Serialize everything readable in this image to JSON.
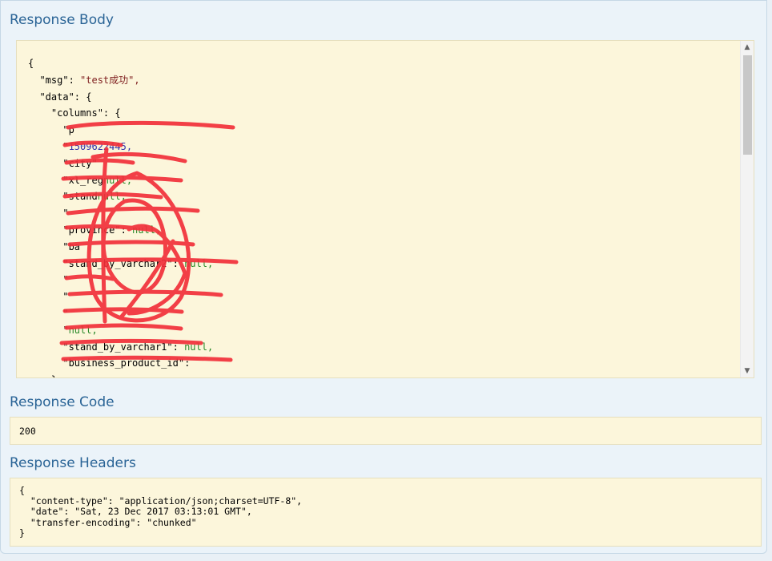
{
  "sections": {
    "response_body": {
      "title": "Response Body",
      "lines": [
        {
          "key": "{",
          "value": "",
          "value_class": ""
        },
        {
          "key": "  \"msg\": ",
          "value": "\"test成功\",",
          "value_class": "str"
        },
        {
          "key": "  \"data\": {",
          "value": "",
          "value_class": ""
        },
        {
          "key": "    \"columns\": {",
          "value": "",
          "value_class": ""
        },
        {
          "key": "      \"p",
          "value": "",
          "value_class": ""
        },
        {
          "key": "      \"",
          "value": "1509622445,",
          "value_class": "num"
        },
        {
          "key": "      \"city\"",
          "value": "",
          "value_class": ""
        },
        {
          "key": "      \"xl_reg",
          "value": "null,",
          "value_class": "nul"
        },
        {
          "key": "      \"stand",
          "value": "null,",
          "value_class": "nul"
        },
        {
          "key": "      \"",
          "value": "",
          "value_class": ""
        },
        {
          "key": "      \"province\": ",
          "value": "null,",
          "value_class": "nul"
        },
        {
          "key": "      \"ba",
          "value": "",
          "value_class": ""
        },
        {
          "key": "      \"stand_by_varchar2\": ",
          "value": "null,",
          "value_class": "nul"
        },
        {
          "key": "      \"",
          "value": "",
          "value_class": ""
        },
        {
          "key": "      \"",
          "value": "",
          "value_class": ""
        },
        {
          "key": "      \"",
          "value": "",
          "value_class": ""
        },
        {
          "key": "      \"",
          "value": "null,",
          "value_class": "nul"
        },
        {
          "key": "      \"stand_by_varchar1\": ",
          "value": "null,",
          "value_class": "nul"
        },
        {
          "key": "      \"business_product_id\": ",
          "value": "",
          "value_class": ""
        },
        {
          "key": "    },",
          "value": "",
          "value_class": ""
        }
      ]
    },
    "response_code": {
      "title": "Response Code",
      "value": "200"
    },
    "response_headers": {
      "title": "Response Headers",
      "lines": [
        "{",
        "  \"content-type\": \"application/json;charset=UTF-8\",",
        "  \"date\": \"Sat, 23 Dec 2017 03:13:01 GMT\",",
        "  \"transfer-encoding\": \"chunked\"",
        "}"
      ]
    }
  },
  "icons": {
    "scroll_up": "chevron-up-icon",
    "scroll_down": "chevron-down-icon"
  },
  "colors": {
    "title": "#2a6496",
    "code_background": "#fcf6db",
    "string": "#7f1f1f",
    "null": "#2a8a2a",
    "number": "#3333aa",
    "redaction": "#f2303a"
  }
}
